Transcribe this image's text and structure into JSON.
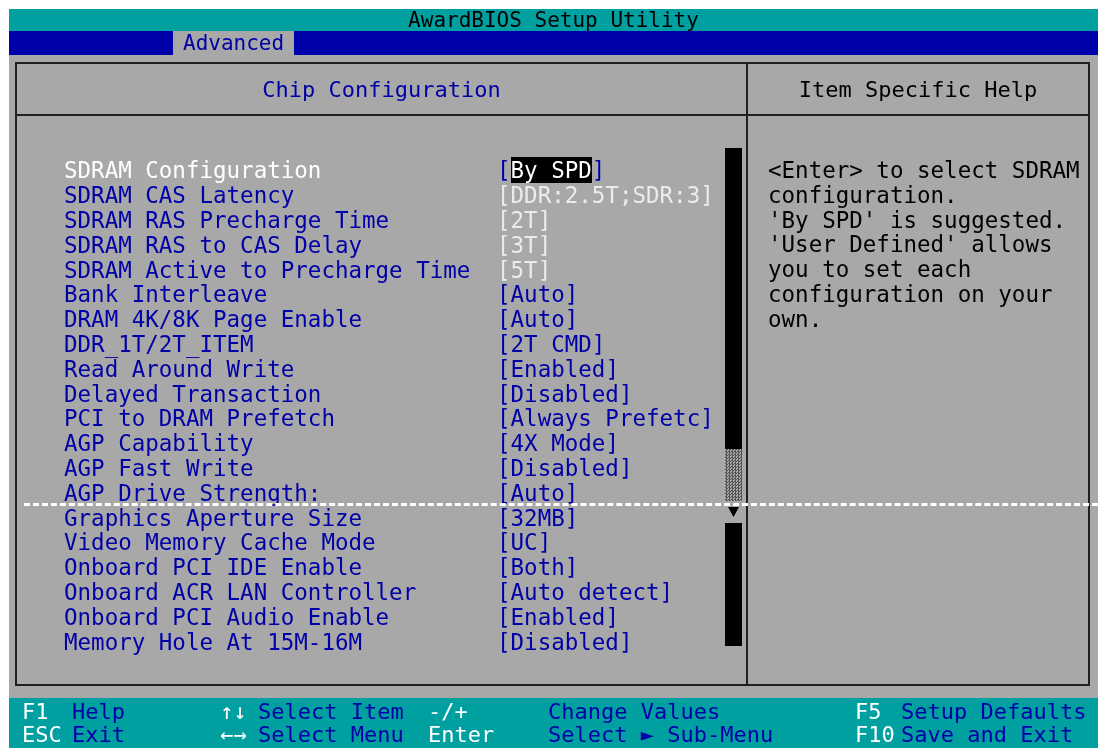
{
  "window": {
    "title": "AwardBIOS Setup Utility"
  },
  "tabs": [
    {
      "label": "Advanced",
      "selected": true
    }
  ],
  "panel": {
    "title": "Chip Configuration",
    "items": [
      {
        "label": "SDRAM Configuration",
        "value": "[By SPD]",
        "selected": true,
        "disabled": false
      },
      {
        "label": "SDRAM CAS Latency",
        "value": "[DDR:2.5T;SDR:3]",
        "selected": false,
        "disabled": true
      },
      {
        "label": "SDRAM RAS Precharge Time",
        "value": "[2T]",
        "selected": false,
        "disabled": true
      },
      {
        "label": "SDRAM RAS to CAS Delay",
        "value": "[3T]",
        "selected": false,
        "disabled": true
      },
      {
        "label": "SDRAM Active to Precharge Time",
        "value": "[5T]",
        "selected": false,
        "disabled": true
      },
      {
        "label": "Bank Interleave",
        "value": "[Auto]",
        "selected": false,
        "disabled": false
      },
      {
        "label": "DRAM 4K/8K Page Enable",
        "value": "[Auto]",
        "selected": false,
        "disabled": false
      },
      {
        "label": "DDR_1T/2T_ITEM",
        "value": "[2T CMD]",
        "selected": false,
        "disabled": false
      },
      {
        "label": "Read Around Write",
        "value": "[Enabled]",
        "selected": false,
        "disabled": false
      },
      {
        "label": "Delayed Transaction",
        "value": "[Disabled]",
        "selected": false,
        "disabled": false
      },
      {
        "label": "PCI to DRAM Prefetch",
        "value": "[Always Prefetc]",
        "selected": false,
        "disabled": false
      },
      {
        "label": "AGP Capability",
        "value": "[4X Mode]",
        "selected": false,
        "disabled": false
      },
      {
        "label": "AGP Fast Write",
        "value": "[Disabled]",
        "selected": false,
        "disabled": false
      },
      {
        "label": "AGP Drive Strength:",
        "value": "[Auto]",
        "selected": false,
        "disabled": false
      },
      {
        "label": "Graphics Aperture Size",
        "value": "[32MB]",
        "selected": false,
        "disabled": false
      },
      {
        "label": "Video Memory Cache Mode",
        "value": "[UC]",
        "selected": false,
        "disabled": false
      },
      {
        "label": "Onboard PCI IDE Enable",
        "value": "[Both]",
        "selected": false,
        "disabled": false
      },
      {
        "label": "Onboard ACR LAN Controller",
        "value": "[Auto detect]",
        "selected": false,
        "disabled": false
      },
      {
        "label": "Onboard PCI Audio Enable",
        "value": "[Enabled]",
        "selected": false,
        "disabled": false
      },
      {
        "label": "Memory Hole At 15M-16M",
        "value": "[Disabled]",
        "selected": false,
        "disabled": false
      }
    ]
  },
  "help": {
    "title": "Item Specific Help",
    "text": "<Enter> to select SDRAM\nconfiguration.\n'By SPD' is suggested.\n'User Defined' allows\nyou to set each\nconfiguration on your\nown."
  },
  "footer": {
    "rows": [
      [
        {
          "key": "F1",
          "action": "Help"
        },
        {
          "key": "↑↓",
          "action": "Select Item"
        },
        {
          "key": "-/+",
          "action": "Change Values"
        },
        {
          "key": "F5",
          "action": "Setup Defaults"
        }
      ],
      [
        {
          "key": "ESC",
          "action": "Exit"
        },
        {
          "key": "←→",
          "action": "Select Menu"
        },
        {
          "key": "Enter",
          "action": "Select ► Sub-Menu"
        },
        {
          "key": "F10",
          "action": "Save and Exit"
        }
      ]
    ]
  }
}
